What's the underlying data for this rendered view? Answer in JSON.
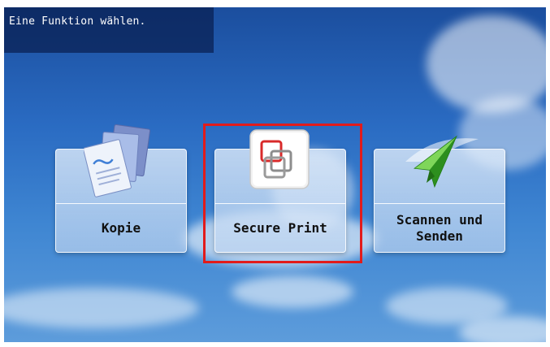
{
  "header": {
    "title": "Eine Funktion wählen."
  },
  "tiles": [
    {
      "label": "Kopie",
      "icon": "copy-documents-icon"
    },
    {
      "label": "Secure Print",
      "icon": "secure-print-icon"
    },
    {
      "label": "Scannen und\nSenden",
      "icon": "paper-plane-icon"
    }
  ],
  "colors": {
    "highlight": "#e21b1b",
    "sky": "#2a6bc2"
  }
}
